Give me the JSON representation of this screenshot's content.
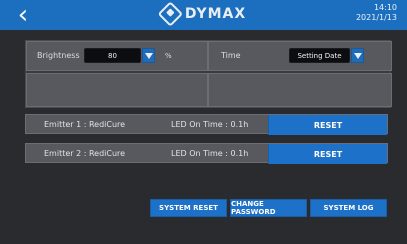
{
  "header": {
    "back_icon": "chevron-left-icon",
    "brand": "DYMAX",
    "time": "14:10",
    "date": "2021/1/13"
  },
  "settings": {
    "brightness_label": "Brightness",
    "brightness_value": "80",
    "brightness_unit": "%",
    "time_label": "Time",
    "time_value": "Setting Date"
  },
  "emitters": [
    {
      "name": "Emitter 1 : RediCure",
      "led": "LED On Time : 0.1h",
      "reset_label": "RESET"
    },
    {
      "name": "Emitter 2 : RediCure",
      "led": "LED On Time : 0.1h",
      "reset_label": "RESET"
    }
  ],
  "footer": {
    "system_reset": "SYSTEM RESET",
    "change_password": "CHANGE PASSWORD",
    "system_log": "SYSTEM LOG"
  },
  "colors": {
    "accent": "#1d71c8",
    "panel": "#57595e",
    "background": "#2a2b2e"
  }
}
